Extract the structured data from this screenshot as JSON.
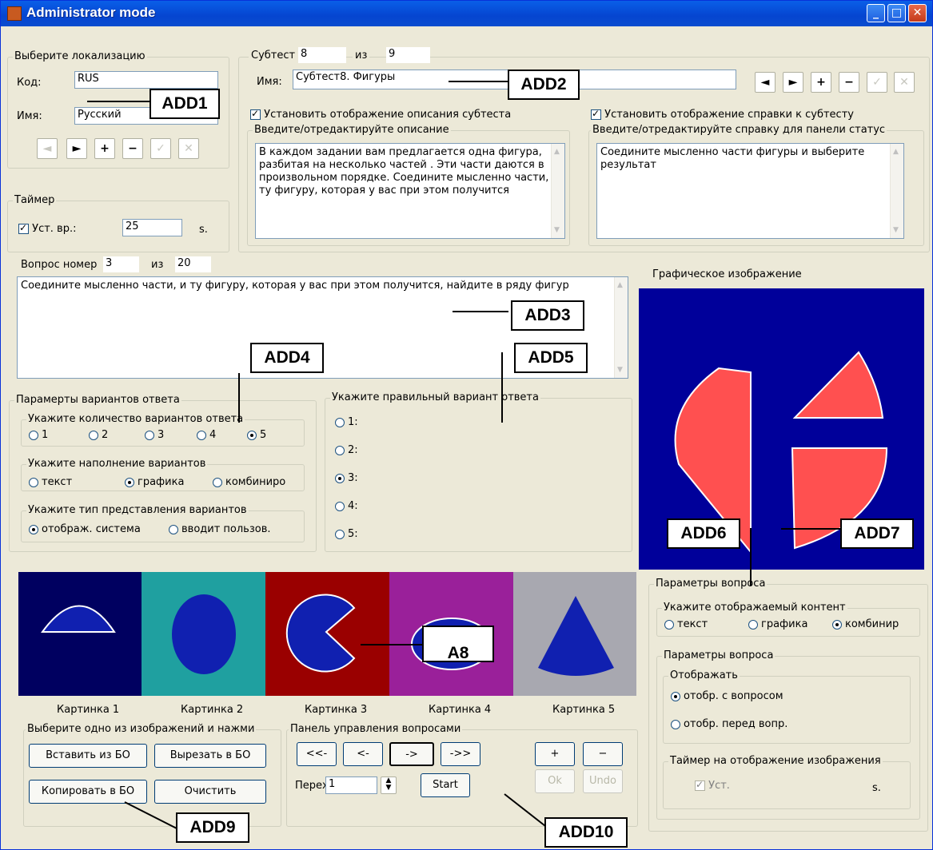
{
  "window": {
    "title": "Administrator mode"
  },
  "localization": {
    "legend": "Выберите локализацию",
    "code_label": "Код:",
    "code_value": "RUS",
    "name_label": "Имя:",
    "name_value": "Русский"
  },
  "timer": {
    "legend": "Таймер",
    "check_label": "Уст. вр.:",
    "value": "25",
    "unit": "s."
  },
  "subtest": {
    "label": "Субтест №",
    "number": "8",
    "of": "из",
    "total": "9",
    "name_label": "Имя:",
    "name_value": "Субтест8. Фигуры",
    "show_desc_label": "Установить отображение описания субтеста",
    "desc_legend": "Введите/отредактируйте описание",
    "desc_text": "В каждом задании вам предлагается одна фигура, разбитая на несколько частей . Эти части даются в произвольном порядке. Соедините мысленно части, и ту фигуру, которая у вас при этом получится",
    "show_help_label": "Установить отображение справки к субтесту",
    "help_legend": "Введите/отредактируйте справку для панели статус",
    "help_text": "Соедините мысленно части фигуры и выберите результат"
  },
  "question": {
    "label": "Вопрос номер",
    "number": "3",
    "of": "из",
    "total": "20",
    "text": "Соедините мысленно части, и ту фигуру, которая у вас при этом получится, найдите в ряду фигур"
  },
  "answer_params": {
    "legend": "Парамерты вариантов ответа",
    "count_legend": "Укажите количество вариантов ответа",
    "counts": [
      "1",
      "2",
      "3",
      "4",
      "5"
    ],
    "fill_legend": "Укажите наполнение вариантов",
    "fills": [
      "текст",
      "графика",
      "комбиниро"
    ],
    "type_legend": "Укажите тип представления вариантов",
    "types": [
      "отображ. система",
      "вводит пользов."
    ]
  },
  "correct": {
    "legend": "Укажите правильный вариант ответа",
    "options": [
      "1:",
      "2:",
      "3:",
      "4:",
      "5:"
    ]
  },
  "graphic": {
    "label": "Графическое изображение"
  },
  "pictures": [
    "Картинка 1",
    "Картинка 2",
    "Картинка 3",
    "Картинка 4",
    "Картинка 5"
  ],
  "image_panel": {
    "legend": "Выберите одно из изображений и нажми",
    "paste": "Вставить из БО",
    "cut": "Вырезать в БО",
    "copy": "Копировать в БО",
    "clear": "Очистить"
  },
  "qpanel": {
    "legend": "Панель управления вопросами",
    "first": "<<-",
    "prev": "<-",
    "next": "->",
    "last": "->>",
    "goto_label": "Переход",
    "goto_value": "1",
    "start": "Start",
    "plus": "+",
    "minus": "−",
    "ok": "Ok",
    "undo": "Undo"
  },
  "qparams": {
    "legend": "Параметры вопроса",
    "content_legend": "Укажите отображаемый контент",
    "contents": [
      "текст",
      "графика",
      "комбинир"
    ],
    "inner_legend": "Параметры вопроса",
    "show_legend": "Отображать",
    "show_opts": [
      "отобр. с вопросом",
      "отобр. перед вопр."
    ],
    "timer_legend": "Таймер на отображение изображения",
    "timer_check": "Уст.",
    "timer_unit": "s."
  },
  "annotations": [
    "ADD1",
    "ADD2",
    "ADD3",
    "ADD4",
    "ADD5",
    "ADD6",
    "ADD7",
    "A8",
    "ADD9",
    "ADD10"
  ],
  "colors": {
    "title_bar": "#0a5fe8",
    "graphic_bg": "#00009a",
    "shape_fill": "#ff5050",
    "pic1_bg": "#000060",
    "pic2_bg": "#1fa0a0",
    "pic3_bg": "#9a0000",
    "pic4_bg": "#9a209a",
    "pic5_bg": "#a8a8b0",
    "shape_blue": "#1020b0"
  }
}
